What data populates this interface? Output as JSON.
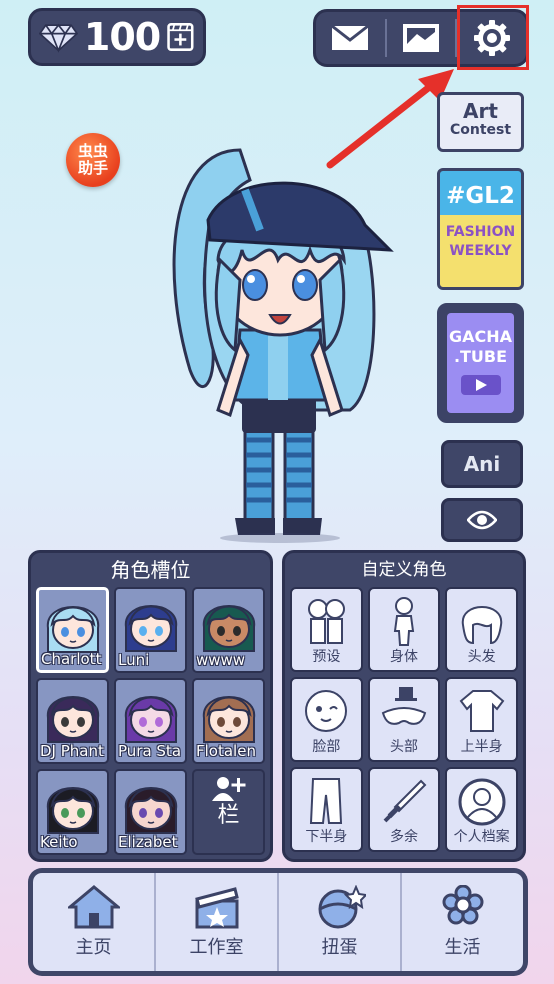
{
  "currency": {
    "gems": "100",
    "gem_icon": "diamond-icon",
    "film_icon": "film-plus-icon"
  },
  "top_buttons": {
    "mail_icon": "mail-icon",
    "gallery_icon": "image-icon",
    "settings_icon": "gear-icon"
  },
  "cc_helper": {
    "label": "虫虫助手"
  },
  "side": {
    "art_contest": {
      "line1": "Art",
      "line2": "Contest"
    },
    "gl2": {
      "tag": "#GL2",
      "line1": "FASHION",
      "line2": "WEEKLY"
    },
    "gacha_tube": {
      "line1": "GACHA",
      "line2": ".TUBE"
    },
    "ani": "Ani"
  },
  "slot_panel": {
    "title": "角色槽位",
    "slots": [
      {
        "name": "Charlott",
        "hair": "#a9dcf2",
        "skin": "#fde6dc",
        "eyes": "#4a8fe0"
      },
      {
        "name": "Luni",
        "hair": "#2d3d8e",
        "skin": "#fde6dc",
        "eyes": "#5ab0ef"
      },
      {
        "name": "wwww",
        "hair": "#185a50",
        "skin": "#c98a66",
        "eyes": "#2b2b2b"
      },
      {
        "name": "DJ Phant",
        "hair": "#3a2a5a",
        "skin": "#fde6dc",
        "eyes": "#3a3a3a"
      },
      {
        "name": "Pura Sta",
        "hair": "#6a3aa8",
        "skin": "#f4d9e6",
        "eyes": "#b06ad8"
      },
      {
        "name": "Flotalen",
        "hair": "#a26e52",
        "skin": "#fde6dc",
        "eyes": "#6e4a3a"
      },
      {
        "name": "Keito",
        "hair": "#1c1c24",
        "skin": "#fde6dc",
        "eyes": "#4a9a5a"
      },
      {
        "name": "Elizabet",
        "hair": "#2a1c2a",
        "skin": "#f6d6cf",
        "eyes": "#6a4ab0"
      }
    ],
    "add_label": "栏"
  },
  "custom_panel": {
    "title": "自定义角色",
    "categories": [
      "预设",
      "身体",
      "头发",
      "脸部",
      "头部",
      "上半身",
      "下半身",
      "多余",
      "个人档案"
    ]
  },
  "nav": [
    {
      "label": "主页",
      "icon": "house-icon"
    },
    {
      "label": "工作室",
      "icon": "clapperboard-icon"
    },
    {
      "label": "扭蛋",
      "icon": "gacha-egg-icon"
    },
    {
      "label": "生活",
      "icon": "flower-icon"
    }
  ],
  "colors": {
    "panel": "#3f4668",
    "accent_red": "#e5302a",
    "tile": "#dfe3f7"
  }
}
